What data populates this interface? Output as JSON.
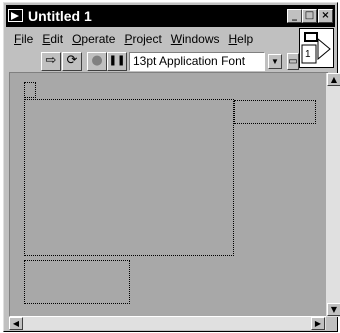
{
  "window": {
    "title": "Untitled 1",
    "minimize_glyph": "_",
    "maximize_glyph": "□",
    "close_glyph": "×"
  },
  "menu": {
    "items": [
      {
        "label": "File",
        "mnemonic": "F",
        "rest": "ile"
      },
      {
        "label": "Edit",
        "mnemonic": "E",
        "rest": "dit"
      },
      {
        "label": "Operate",
        "mnemonic": "O",
        "rest": "perate"
      },
      {
        "label": "Project",
        "mnemonic": "P",
        "rest": "roject"
      },
      {
        "label": "Windows",
        "mnemonic": "W",
        "rest": "indows"
      },
      {
        "label": "Help",
        "mnemonic": "H",
        "rest": "elp"
      }
    ]
  },
  "toolbar": {
    "run_glyph": "⇨",
    "run_continuous_glyph": "⟳",
    "abort_glyph": "●",
    "pause_glyph": "❚❚",
    "font_value": "13pt Application Font",
    "dropdown_glyph": "▼",
    "align_glyph": "▭"
  },
  "vi_icon": {
    "connector_label": "1"
  },
  "scrollbars": {
    "up": "▲",
    "down": "▼",
    "left": "◀",
    "right": "▶"
  },
  "colors": {
    "canvas": "#a8a8a8",
    "titlebar": "#000000",
    "chrome": "#c0c0c0"
  }
}
